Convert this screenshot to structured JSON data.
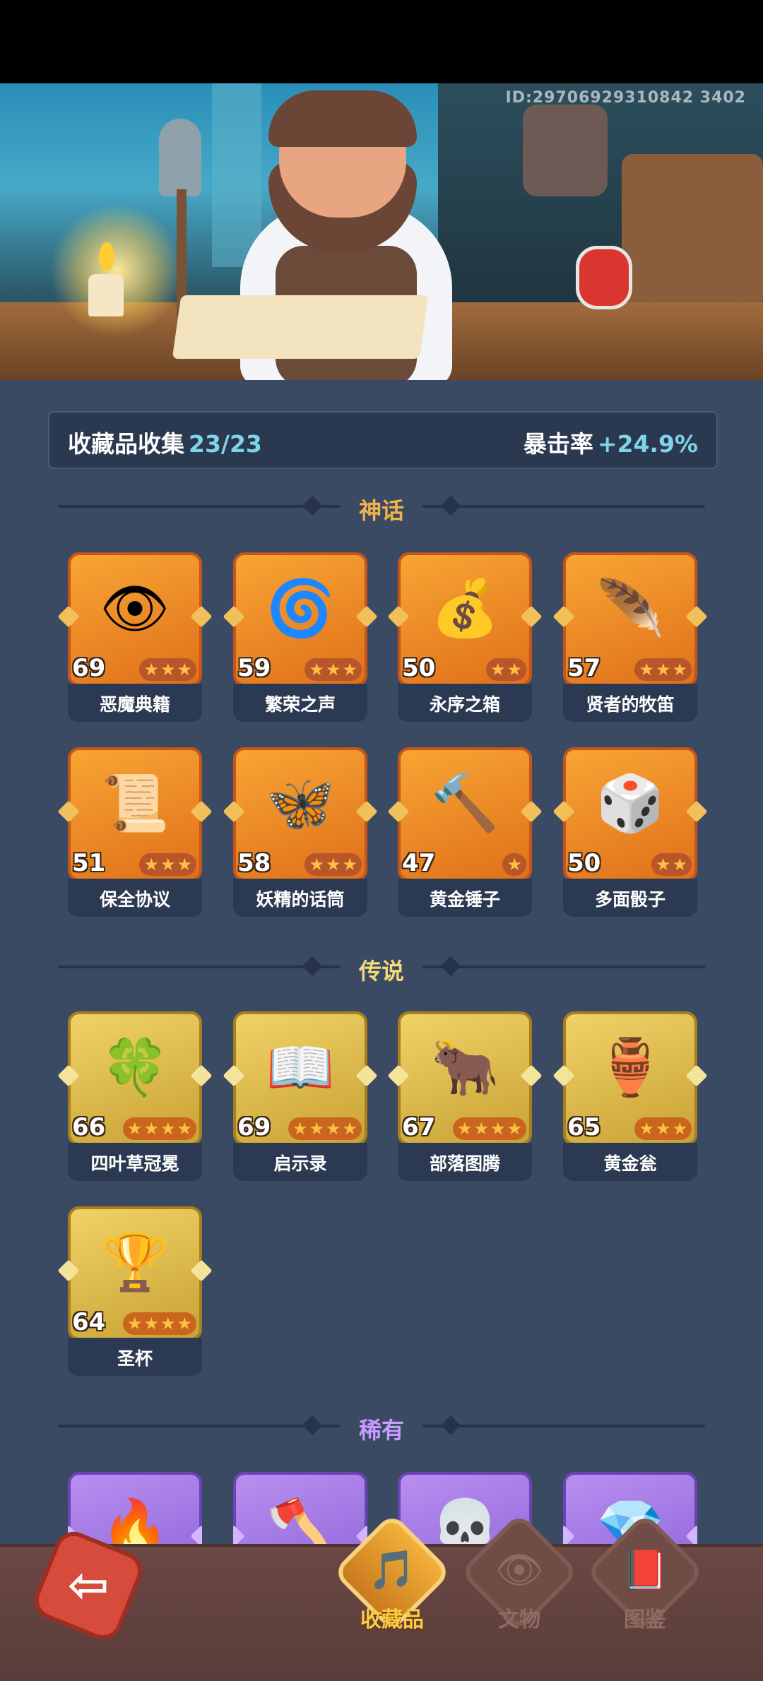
{
  "header": {
    "player_id": "ID:29706929310842 3402"
  },
  "summary": {
    "label": "收藏品收集",
    "collected": "23/23",
    "bonus_label": "暴击率",
    "bonus_value": "+24.9%"
  },
  "sections": {
    "mythic": {
      "title": "神话",
      "color": "#f5b24a"
    },
    "legend": {
      "title": "传说",
      "color": "#f2d97a"
    },
    "rare": {
      "title": "稀有",
      "color": "#c79bff"
    }
  },
  "mythic_items": [
    {
      "name": "恶魔典籍",
      "level": "69",
      "stars": 3,
      "icon": "eye-book-icon",
      "glyph": "👁"
    },
    {
      "name": "繁荣之声",
      "level": "59",
      "stars": 3,
      "icon": "blue-spirit-icon",
      "glyph": "🌀"
    },
    {
      "name": "永序之箱",
      "level": "50",
      "stars": 2,
      "icon": "gold-chest-icon",
      "glyph": "💰"
    },
    {
      "name": "贤者的牧笛",
      "level": "57",
      "stars": 3,
      "icon": "flute-icon",
      "glyph": "🪶"
    },
    {
      "name": "保全协议",
      "level": "51",
      "stars": 3,
      "icon": "scroll-icon",
      "glyph": "📜"
    },
    {
      "name": "妖精的话筒",
      "level": "58",
      "stars": 3,
      "icon": "fairy-mic-icon",
      "glyph": "🦋"
    },
    {
      "name": "黄金锤子",
      "level": "47",
      "stars": 1,
      "icon": "hammer-icon",
      "glyph": "🔨"
    },
    {
      "name": "多面骰子",
      "level": "50",
      "stars": 2,
      "icon": "dice-icon",
      "glyph": "🎲"
    }
  ],
  "legend_items": [
    {
      "name": "四叶草冠冕",
      "level": "66",
      "stars": 4,
      "icon": "clover-crown-icon",
      "glyph": "🍀"
    },
    {
      "name": "启示录",
      "level": "69",
      "stars": 4,
      "icon": "open-book-icon",
      "glyph": "📖"
    },
    {
      "name": "部落图腾",
      "level": "67",
      "stars": 4,
      "icon": "totem-icon",
      "glyph": "🐂"
    },
    {
      "name": "黄金瓮",
      "level": "65",
      "stars": 3,
      "icon": "golden-urn-icon",
      "glyph": "🏺"
    },
    {
      "name": "圣杯",
      "level": "64",
      "stars": 4,
      "icon": "holy-grail-icon",
      "glyph": "🏆"
    }
  ],
  "rare_items": [
    {
      "icon": "fire-feather-icon",
      "glyph": "🔥"
    },
    {
      "icon": "axe-icon",
      "glyph": "🪓"
    },
    {
      "icon": "bull-skull-icon",
      "glyph": "💀"
    },
    {
      "icon": "crystal-icon",
      "glyph": "💎"
    }
  ],
  "nav": {
    "back_icon": "back-arrow-icon",
    "tabs": [
      {
        "label": "收藏品",
        "icon": "harp-icon",
        "glyph": "🎵",
        "active": true
      },
      {
        "label": "文物",
        "icon": "eye-icon",
        "glyph": "👁",
        "active": false
      },
      {
        "label": "图鉴",
        "icon": "book-icon",
        "glyph": "📕",
        "active": false
      }
    ]
  }
}
